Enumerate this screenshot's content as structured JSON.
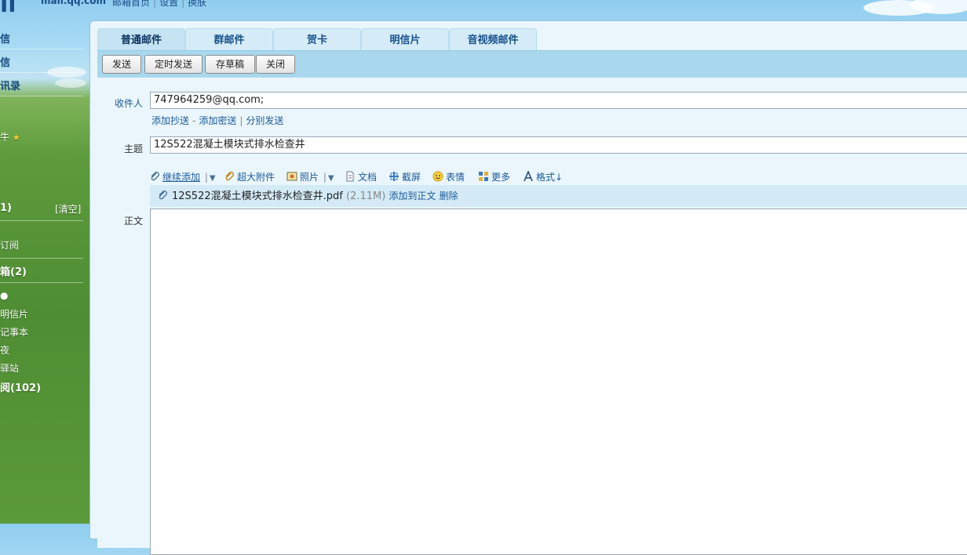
{
  "header": {
    "logo": "il",
    "url": "mail.qq.com",
    "links": [
      "邮箱首页",
      "设置",
      "换肤"
    ]
  },
  "sidebar": {
    "items": [
      "信",
      "信",
      "讯录"
    ],
    "star_label": "牛",
    "folder_count": "1)",
    "clear_label": "[清空]",
    "subscribe": "订阅",
    "folder2": "箱(2)",
    "apps": [
      "明信片",
      "记事本",
      "夜",
      "驿站"
    ],
    "folder3": "阅(102)"
  },
  "tabs": [
    "普通邮件",
    "群邮件",
    "贺卡",
    "明信片",
    "音视频邮件"
  ],
  "toolbar": {
    "send": "发送",
    "schedule": "定时发送",
    "draft": "存草稿",
    "close": "关闭"
  },
  "compose": {
    "to_label": "收件人",
    "to_value": "747964259@qq.com;",
    "cc_link": "添加抄送",
    "bcc_link": "添加密送",
    "separate_link": "分别发送",
    "subject_label": "主题",
    "subject_value": "12S522混凝土模块式排水检查井",
    "body_label": "正文"
  },
  "attach_toolbar": {
    "continue_add": "继续添加",
    "large_attach": "超大附件",
    "photo": "照片",
    "document": "文档",
    "screenshot": "截屏",
    "emoji": "表情",
    "more": "更多",
    "format": "格式↓"
  },
  "attachment": {
    "filename": "12S522混凝土模块式排水检查井.pdf",
    "size": "(2.11M)",
    "add_to_body": "添加到正文",
    "delete": "删除"
  },
  "colors": {
    "accent": "#16508a",
    "panel_bg": "#eaf6fc",
    "toolbar_bg": "#a9d8ee"
  }
}
